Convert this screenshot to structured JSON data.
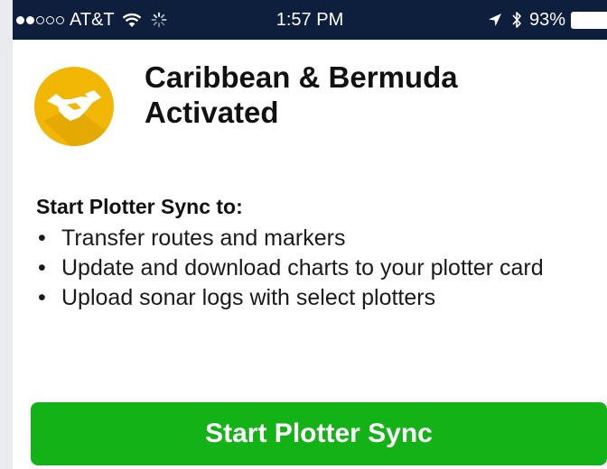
{
  "status_bar": {
    "carrier": "AT&T",
    "time": "1:57 PM",
    "battery_percent": "93%",
    "signal_bars_filled": 2,
    "signal_bars_total": 5,
    "icons": [
      "wifi-icon",
      "loading-spinner-icon",
      "location-arrow-icon",
      "bluetooth-icon",
      "battery-icon"
    ],
    "background": "#0e1f3d"
  },
  "header": {
    "title_line1": "Caribbean & Bermuda",
    "title_line2": "Activated",
    "logo_icon": "handshake-icon",
    "logo_color": "#f2b705"
  },
  "content": {
    "intro": "Start Plotter Sync to:",
    "bullets": [
      "Transfer routes and markers",
      "Update and download charts to your plotter card",
      "Upload sonar logs with select plotters"
    ]
  },
  "button": {
    "label": "Start Plotter Sync",
    "color": "#13b317"
  }
}
